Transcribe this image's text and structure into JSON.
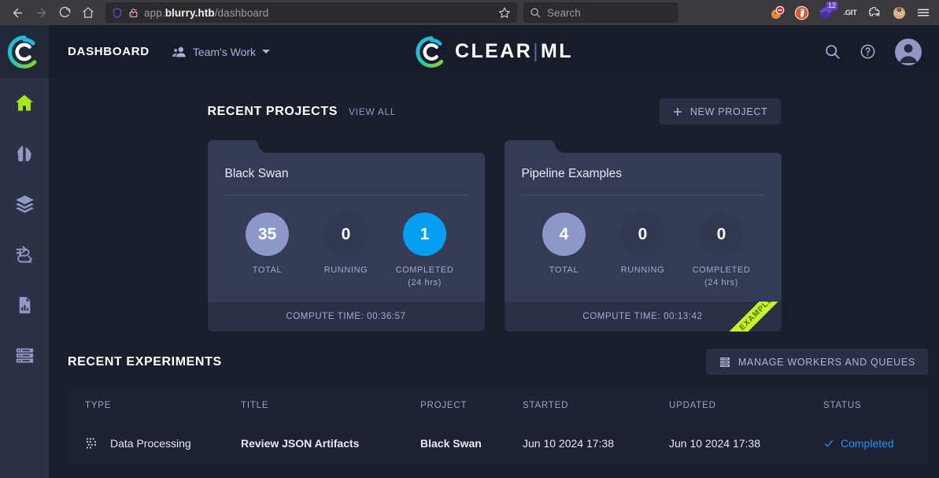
{
  "browser": {
    "back_icon": "back-arrow-icon",
    "forward_icon": "forward-arrow-icon",
    "reload_icon": "reload-icon",
    "home_icon": "home-icon",
    "url_prefix": "app.",
    "url_host": "blurry.htb",
    "url_path": "/dashboard",
    "url_full": "app.blurry.htb/dashboard",
    "shield_icon": "shield-icon",
    "lock_broken_icon": "broken-lock-icon",
    "bookmark_icon": "star-icon",
    "search_placeholder": "Search",
    "search_icon": "search-icon",
    "extensions": [
      {
        "name": "no-entry-extension-icon",
        "badge": ""
      },
      {
        "name": "duckduckgo-extension-icon",
        "badge": ""
      },
      {
        "name": "downloads-icon",
        "badge": "12"
      },
      {
        "name": "git-extension-icon",
        "label": ".GIT",
        "badge": ""
      },
      {
        "name": "puzzle-extension-icon",
        "badge": ""
      },
      {
        "name": "profile-avatar-icon",
        "badge": ""
      },
      {
        "name": "hamburger-menu-icon",
        "badge": ""
      }
    ]
  },
  "sidebar": {
    "logo_alt": "clearml-logo",
    "items": [
      {
        "name": "sidebar-item-home",
        "icon": "home-icon",
        "active": true
      },
      {
        "name": "sidebar-item-models",
        "icon": "brain-icon",
        "active": false
      },
      {
        "name": "sidebar-item-datasets",
        "icon": "layers-icon",
        "active": false
      },
      {
        "name": "sidebar-item-pipelines",
        "icon": "pipeline-icon",
        "active": false
      },
      {
        "name": "sidebar-item-reports",
        "icon": "report-icon",
        "active": false
      },
      {
        "name": "sidebar-item-workers",
        "icon": "server-icon",
        "active": false
      }
    ]
  },
  "header": {
    "title": "DASHBOARD",
    "workspace_label": "Team's Work",
    "workspace_icon": "people-icon",
    "logo_text_1": "CLEAR",
    "logo_sep": "|",
    "logo_text_2": "ML",
    "search_icon": "search-icon",
    "help_icon": "help-icon",
    "avatar_icon": "user-avatar-icon"
  },
  "projects": {
    "section_title": "RECENT PROJECTS",
    "view_all": "VIEW ALL",
    "new_project_label": "NEW PROJECT",
    "plus_icon": "plus-icon",
    "stat_labels": {
      "total": "TOTAL",
      "running": "RUNNING",
      "completed": "COMPLETED",
      "completed_sub": "(24 hrs)"
    },
    "compute_prefix": "COMPUTE TIME:",
    "cards": [
      {
        "name": "Black Swan",
        "total": "35",
        "running": "0",
        "completed": "1",
        "compute_time": "COMPUTE TIME: 00:36:57",
        "is_example": false,
        "completed_highlight": true
      },
      {
        "name": "Pipeline Examples",
        "total": "4",
        "running": "0",
        "completed": "0",
        "compute_time": "COMPUTE TIME: 00:13:42",
        "is_example": true,
        "example_label": "EXAMPLE",
        "completed_highlight": false
      }
    ]
  },
  "experiments": {
    "section_title": "RECENT EXPERIMENTS",
    "manage_label": "MANAGE WORKERS AND QUEUES",
    "manage_icon": "server-rack-icon",
    "columns": [
      "TYPE",
      "TITLE",
      "PROJECT",
      "STARTED",
      "UPDATED",
      "STATUS"
    ],
    "rows": [
      {
        "type": "Data Processing",
        "type_icon": "data-processing-icon",
        "title": "Review JSON Artifacts",
        "project": "Black Swan",
        "started": "Jun 10 2024 17:38",
        "updated": "Jun 10 2024 17:38",
        "status": "Completed",
        "status_icon": "check-icon"
      }
    ]
  },
  "colors": {
    "accent_blue": "#069ef3",
    "accent_green": "#a3e818",
    "ribbon_green": "#c5f32a",
    "bubble_periwinkle": "#8e98c8",
    "page_bg": "#1a1e2d",
    "card_bg": "#353b54"
  }
}
